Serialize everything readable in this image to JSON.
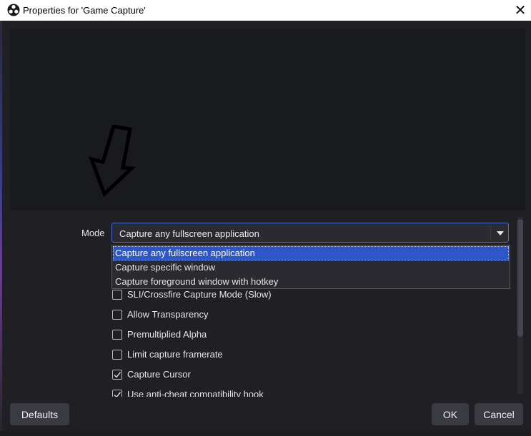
{
  "window": {
    "title": "Properties for 'Game Capture'",
    "close_glyph": "✕",
    "app_icon": "obs-logo-icon"
  },
  "mode": {
    "label": "Mode",
    "selected": "Capture any fullscreen application",
    "options": [
      "Capture any fullscreen application",
      "Capture specific window",
      "Capture foreground window with hotkey"
    ],
    "accent": "#476bd9",
    "highlight": "#2d57c7"
  },
  "checkboxes": [
    {
      "label": "SLI/Crossfire Capture Mode (Slow)",
      "checked": false
    },
    {
      "label": "Allow Transparency",
      "checked": false
    },
    {
      "label": "Premultiplied Alpha",
      "checked": false
    },
    {
      "label": "Limit capture framerate",
      "checked": false
    },
    {
      "label": "Capture Cursor",
      "checked": true
    },
    {
      "label": "Use anti-cheat compatibility hook",
      "checked": true
    }
  ],
  "buttons": {
    "defaults": "Defaults",
    "ok": "OK",
    "cancel": "Cancel"
  },
  "annotation": {
    "icon": "down-arrow-annotation-icon"
  }
}
